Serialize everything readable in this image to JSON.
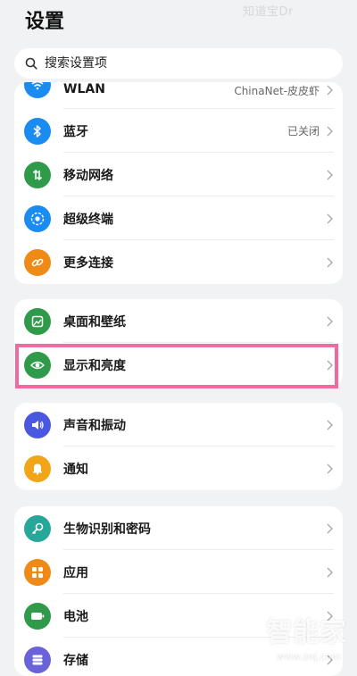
{
  "watermark_top": "知道宝Dr",
  "title": "设置",
  "search": {
    "placeholder": "搜索设置项"
  },
  "colors": {
    "wlan": "#1a8bf0",
    "bluetooth": "#1a8bf0",
    "mobile": "#2e9a4a",
    "super_terminal": "#1a8bf0",
    "more_connect": "#f08a16",
    "wallpaper": "#2e9a4a",
    "display": "#2e9a4a",
    "sound": "#4a57e0",
    "notify": "#f2a516",
    "biometric": "#27a69a",
    "apps": "#f08a16",
    "battery": "#2e9a4a",
    "storage": "#6a62d8",
    "highlight": "#f06aa0"
  },
  "group1": {
    "items": [
      {
        "label": "WLAN",
        "value": "ChinaNet-皮皮虾",
        "icon": "wifi-icon"
      },
      {
        "label": "蓝牙",
        "value": "已关闭",
        "icon": "bluetooth-icon"
      },
      {
        "label": "移动网络",
        "value": "",
        "icon": "mobile-network-icon"
      },
      {
        "label": "超级终端",
        "value": "",
        "icon": "super-terminal-icon"
      },
      {
        "label": "更多连接",
        "value": "",
        "icon": "link-icon"
      }
    ]
  },
  "group2": {
    "items": [
      {
        "label": "桌面和壁纸",
        "icon": "wallpaper-icon"
      },
      {
        "label": "显示和亮度",
        "icon": "eye-icon"
      }
    ]
  },
  "group3": {
    "items": [
      {
        "label": "声音和振动",
        "icon": "speaker-icon"
      },
      {
        "label": "通知",
        "icon": "bell-icon"
      }
    ]
  },
  "group4": {
    "items": [
      {
        "label": "生物识别和密码",
        "icon": "key-icon"
      },
      {
        "label": "应用",
        "icon": "apps-grid-icon"
      },
      {
        "label": "电池",
        "icon": "battery-icon"
      },
      {
        "label": "存储",
        "icon": "storage-icon"
      }
    ]
  },
  "watermark_brand": {
    "logo": "智能家",
    "url": "www.znj.com"
  }
}
